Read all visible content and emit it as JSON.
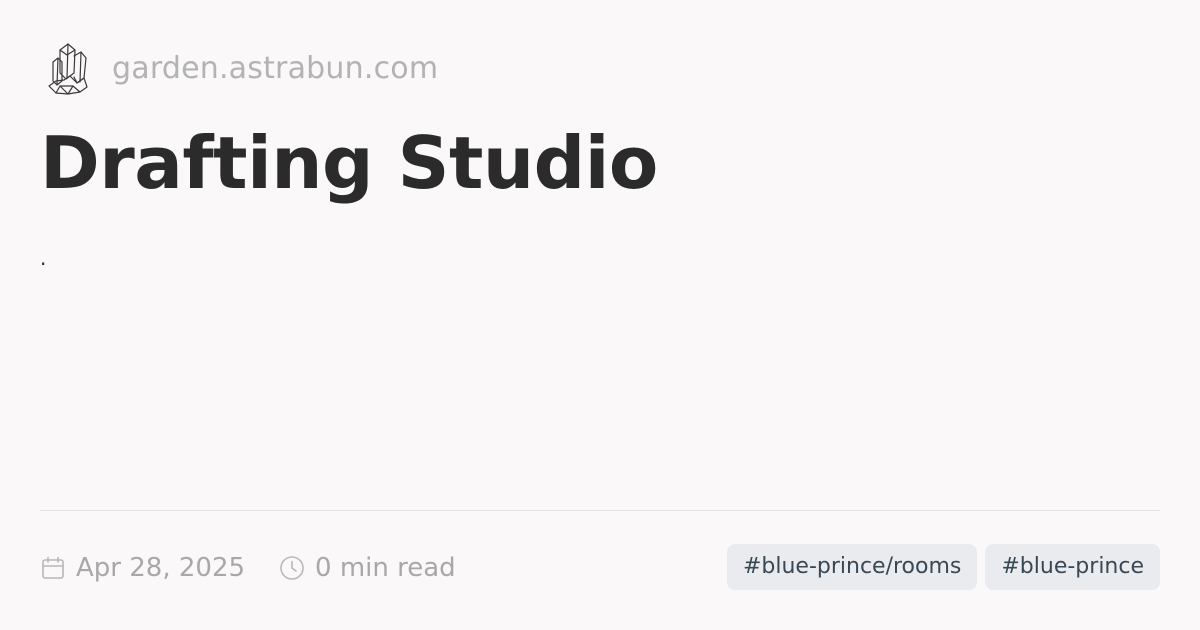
{
  "site": {
    "logo_icon": "crystal-cluster-icon",
    "domain": "garden.astrabun.com"
  },
  "page": {
    "title": "Drafting Studio",
    "description": "."
  },
  "meta": {
    "date_icon": "calendar-icon",
    "date": "Apr 28, 2025",
    "reading_icon": "clock-icon",
    "reading_time": "0 min read"
  },
  "tags": [
    "#blue-prince/rooms",
    "#blue-prince"
  ],
  "colors": {
    "background": "#faf8f8",
    "title": "#2b2b2b",
    "muted": "#a8a8a8",
    "tag_background": "#e9ebee",
    "tag_text": "#384955"
  }
}
